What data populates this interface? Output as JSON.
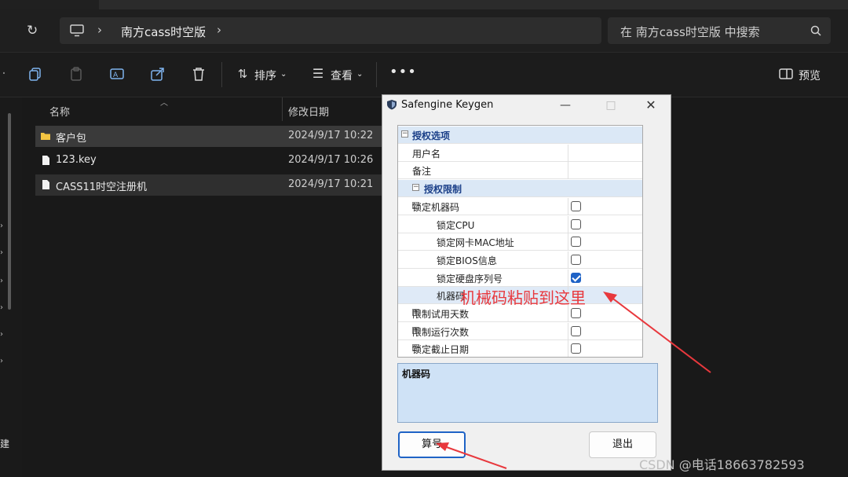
{
  "explorer": {
    "breadcrumb": "南方cass时空版",
    "search_placeholder": "在 南方cass时空版 中搜索",
    "toolbar": {
      "sort_label": "排序",
      "view_label": "查看",
      "preview_label": "预览"
    },
    "columns": {
      "name": "名称",
      "modified": "修改日期"
    },
    "files": [
      {
        "name": "客户包",
        "date": "2024/9/17 10:22",
        "kind": "folder"
      },
      {
        "name": "123.key",
        "date": "2024/9/17 10:26",
        "kind": "file"
      },
      {
        "name": "CASS11时空注册机",
        "date": "2024/9/17 10:21",
        "kind": "file"
      }
    ],
    "left_fragment": "建"
  },
  "dialog": {
    "title": "Safengine Keygen",
    "rows": [
      {
        "label": "授权选项",
        "type": "category",
        "level": 0,
        "expander": "−"
      },
      {
        "label": "用户名",
        "type": "text",
        "level": 1
      },
      {
        "label": "备注",
        "type": "text",
        "level": 1
      },
      {
        "label": "授权限制",
        "type": "category",
        "level": 1,
        "expander": "−"
      },
      {
        "label": "锁定机器码",
        "type": "check",
        "level": 1,
        "expander": "−",
        "checked": false
      },
      {
        "label": "锁定CPU",
        "type": "check",
        "level": 2,
        "checked": false
      },
      {
        "label": "锁定网卡MAC地址",
        "type": "check",
        "level": 2,
        "checked": false
      },
      {
        "label": "锁定BIOS信息",
        "type": "check",
        "level": 2,
        "checked": false
      },
      {
        "label": "锁定硬盘序列号",
        "type": "check",
        "level": 2,
        "checked": true
      },
      {
        "label": "机器码",
        "type": "text",
        "level": 2,
        "selected": true
      },
      {
        "label": "限制试用天数",
        "type": "check",
        "level": 1,
        "expander": "+",
        "checked": false
      },
      {
        "label": "限制运行次数",
        "type": "check",
        "level": 1,
        "expander": "+",
        "checked": false
      },
      {
        "label": "锁定截止日期",
        "type": "check",
        "level": 1,
        "expander": "+",
        "checked": false
      }
    ],
    "description_title": "机器码",
    "generate_label": "算号",
    "exit_label": "退出"
  },
  "annotation": "机械码粘贴到这里",
  "watermark": "CSDN @电话18663782593",
  "colors": {
    "accent": "#1f63c6",
    "annotation": "#e8383d",
    "dark_bg": "#1c1c1c"
  }
}
